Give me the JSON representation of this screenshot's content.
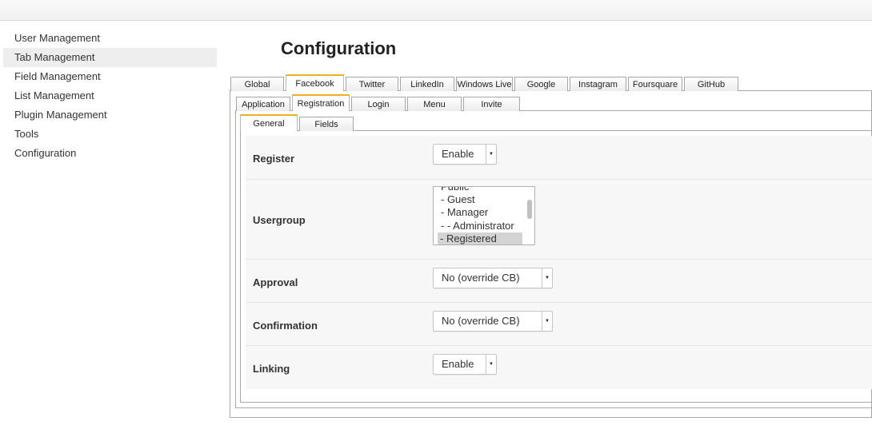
{
  "sidebar": {
    "items": [
      {
        "label": "User Management",
        "active": false
      },
      {
        "label": "Tab Management",
        "active": true
      },
      {
        "label": "Field Management",
        "active": false
      },
      {
        "label": "List Management",
        "active": false
      },
      {
        "label": "Plugin Management",
        "active": false
      },
      {
        "label": "Tools",
        "active": false
      },
      {
        "label": "Configuration",
        "active": false
      }
    ]
  },
  "page": {
    "title": "Configuration"
  },
  "tabs_level1": {
    "items": [
      "Global",
      "Facebook",
      "Twitter",
      "LinkedIn",
      "Windows Live",
      "Google",
      "Instagram",
      "Foursquare",
      "GitHub"
    ],
    "active": "Facebook"
  },
  "tabs_level2": {
    "items": [
      "Application",
      "Registration",
      "Login",
      "Menu",
      "Invite"
    ],
    "active": "Registration"
  },
  "tabs_level3": {
    "items": [
      "General",
      "Fields"
    ],
    "active": "General"
  },
  "form": {
    "register": {
      "label": "Register",
      "value": "Enable"
    },
    "usergroup": {
      "label": "Usergroup",
      "options": [
        "Public",
        "- Guest",
        "- Manager",
        "- - Administrator",
        "- Registered"
      ],
      "selected": "- Registered"
    },
    "approval": {
      "label": "Approval",
      "value": "No (override CB)"
    },
    "confirmation": {
      "label": "Confirmation",
      "value": "No (override CB)"
    },
    "linking": {
      "label": "Linking",
      "value": "Enable"
    }
  },
  "icons": {
    "select_arrow": "▼"
  },
  "colors": {
    "active_tab_accent": "#f2b01e",
    "sidebar_active_bg": "#eeeeee",
    "row_bg": "#f7f7f7"
  }
}
